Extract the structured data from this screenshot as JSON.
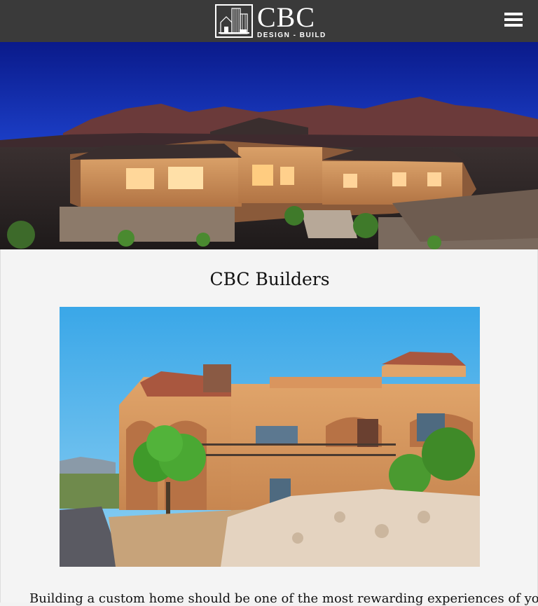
{
  "header": {
    "logo_main": "CBC",
    "logo_sub": "DESIGN - BUILD",
    "menu_icon": "hamburger-menu-icon",
    "background": "#3a3a3a"
  },
  "hero": {
    "image": "luxury-home-at-dusk-mountain-backdrop"
  },
  "main": {
    "title": "CBC Builders",
    "feature_image": "stucco-home-desert-landscape",
    "intro_text": "Building a custom home should be one of the most rewarding experiences of your"
  }
}
